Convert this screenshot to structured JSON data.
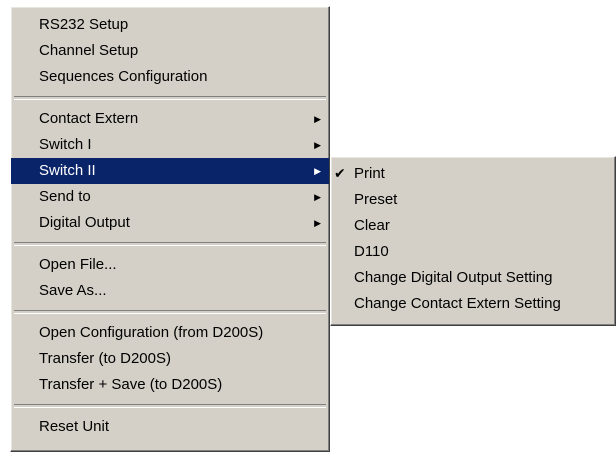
{
  "main_menu": {
    "items": [
      {
        "label": "RS232 Setup"
      },
      {
        "label": "Channel Setup"
      },
      {
        "label": "Sequences Configuration"
      },
      {
        "label": "Contact Extern"
      },
      {
        "label": "Switch I"
      },
      {
        "label": "Switch II"
      },
      {
        "label": "Send to"
      },
      {
        "label": "Digital Output"
      },
      {
        "label": "Open File..."
      },
      {
        "label": "Save As..."
      },
      {
        "label": "Open Configuration (from D200S)"
      },
      {
        "label": "Transfer (to D200S)"
      },
      {
        "label": "Transfer + Save (to D200S)"
      },
      {
        "label": "Reset Unit"
      }
    ],
    "highlighted": "Switch II",
    "submenu_arrow_icon": "arrow-right-icon"
  },
  "submenu": {
    "items": [
      {
        "label": "Print",
        "checked": true
      },
      {
        "label": "Preset"
      },
      {
        "label": "Clear"
      },
      {
        "label": "D110"
      },
      {
        "label": "Change Digital Output Setting"
      },
      {
        "label": "Change Contact Extern Setting"
      }
    ],
    "check_icon": "checkmark-icon"
  },
  "colors": {
    "menu_bg": "#d4d0c8",
    "highlight_bg": "#0a246a",
    "highlight_fg": "#ffffff"
  }
}
